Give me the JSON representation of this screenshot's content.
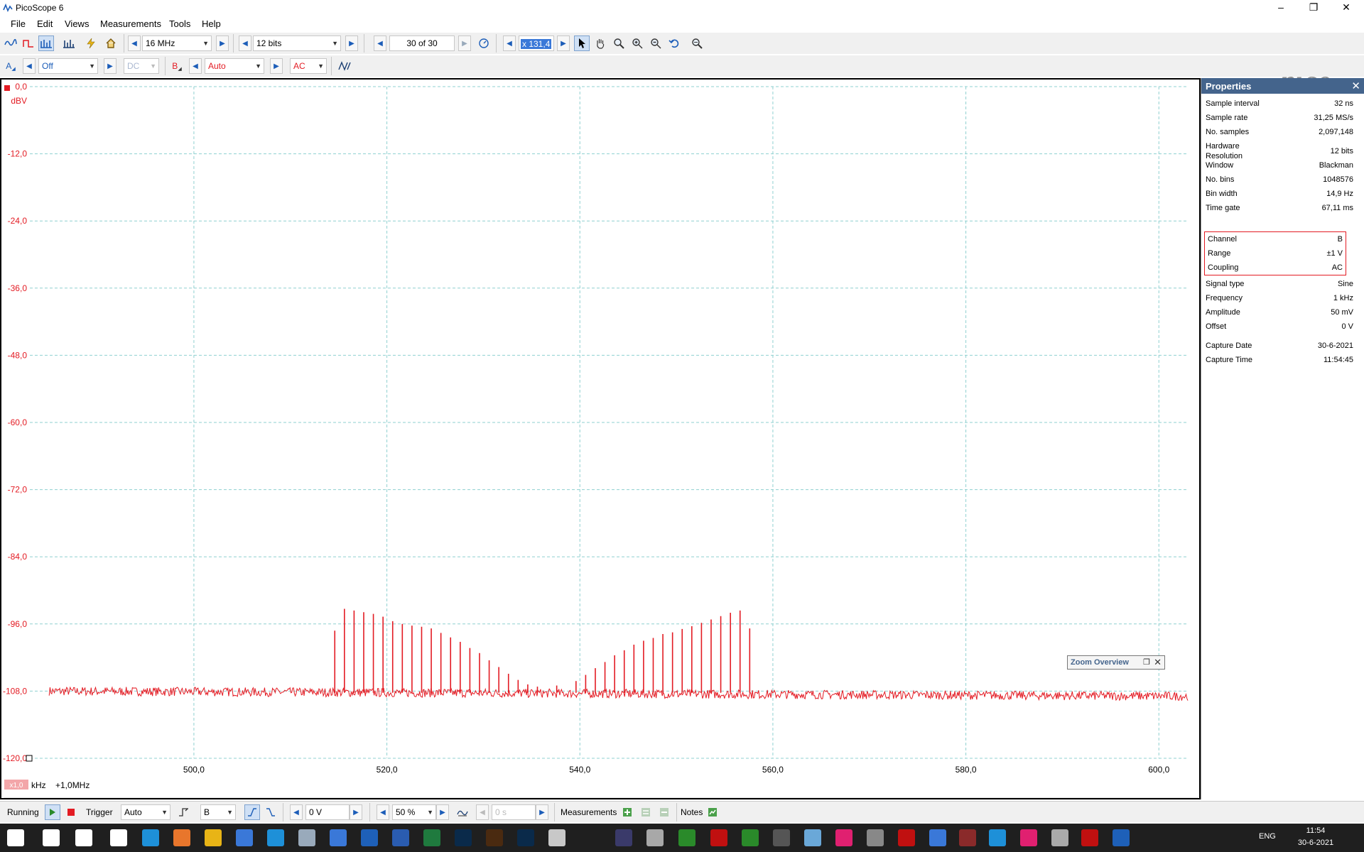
{
  "window": {
    "title": "PicoScope 6"
  },
  "menu": {
    "file": "File",
    "edit": "Edit",
    "views": "Views",
    "measurements": "Measurements",
    "tools": "Tools",
    "help": "Help"
  },
  "toolbar1": {
    "bandwidth": "16 MHz",
    "resolution": "12 bits",
    "buffer": "30 of 30",
    "zoom": "x 131,4"
  },
  "toolbar2": {
    "chA_label": "A",
    "chA_range": "Off",
    "chA_coupling": "DC",
    "chB_label": "B",
    "chB_range": "Auto",
    "chB_coupling": "AC"
  },
  "colors": {
    "channel_b": "#e31b23",
    "grid": "#8fd0d0",
    "accent": "#44648c"
  },
  "chart_data": {
    "type": "line",
    "y_unit": "dBV",
    "x_unit": "kHz",
    "x_offset_label": "+1,0MHz",
    "scale_badge": "x1,0",
    "y_ticks": [
      "0,0",
      "-12,0",
      "-24,0",
      "-36,0",
      "-48,0",
      "-60,0",
      "-72,0",
      "-84,0",
      "-96,0",
      "-108,0",
      "-120,0"
    ],
    "x_ticks": [
      "500,0",
      "520,0",
      "540,0",
      "560,0",
      "580,0",
      "600,0"
    ],
    "ylim": [
      -120,
      0
    ],
    "xlim": [
      483,
      603
    ],
    "noise_floor_start": -108.0,
    "noise_floor_end": -108.9,
    "noise_x_range": [
      485,
      603
    ],
    "spurs": [
      {
        "x": 514.6,
        "y": -97.2
      },
      {
        "x": 515.6,
        "y": -93.3
      },
      {
        "x": 516.6,
        "y": -93.6
      },
      {
        "x": 517.6,
        "y": -93.9
      },
      {
        "x": 518.6,
        "y": -94.2
      },
      {
        "x": 519.6,
        "y": -94.7
      },
      {
        "x": 520.6,
        "y": -95.5
      },
      {
        "x": 521.6,
        "y": -96.0
      },
      {
        "x": 522.6,
        "y": -96.3
      },
      {
        "x": 523.6,
        "y": -96.5
      },
      {
        "x": 524.6,
        "y": -96.8
      },
      {
        "x": 525.6,
        "y": -97.6
      },
      {
        "x": 526.6,
        "y": -98.4
      },
      {
        "x": 527.6,
        "y": -99.2
      },
      {
        "x": 528.6,
        "y": -100.3
      },
      {
        "x": 529.6,
        "y": -101.2
      },
      {
        "x": 530.6,
        "y": -102.5
      },
      {
        "x": 531.6,
        "y": -103.7
      },
      {
        "x": 532.6,
        "y": -104.9
      },
      {
        "x": 533.6,
        "y": -106.0
      },
      {
        "x": 534.6,
        "y": -106.8
      },
      {
        "x": 535.6,
        "y": -107.2
      },
      {
        "x": 537.6,
        "y": -107.0
      },
      {
        "x": 539.6,
        "y": -106.2
      },
      {
        "x": 540.6,
        "y": -105.1
      },
      {
        "x": 541.6,
        "y": -103.9
      },
      {
        "x": 542.6,
        "y": -102.8
      },
      {
        "x": 543.6,
        "y": -101.6
      },
      {
        "x": 544.6,
        "y": -100.7
      },
      {
        "x": 545.6,
        "y": -99.7
      },
      {
        "x": 546.6,
        "y": -99.0
      },
      {
        "x": 547.6,
        "y": -98.5
      },
      {
        "x": 548.6,
        "y": -97.8
      },
      {
        "x": 549.6,
        "y": -97.5
      },
      {
        "x": 550.6,
        "y": -96.9
      },
      {
        "x": 551.6,
        "y": -96.4
      },
      {
        "x": 552.6,
        "y": -95.8
      },
      {
        "x": 553.6,
        "y": -95.2
      },
      {
        "x": 554.6,
        "y": -94.6
      },
      {
        "x": 555.6,
        "y": -94.0
      },
      {
        "x": 556.6,
        "y": -93.6
      },
      {
        "x": 557.6,
        "y": -96.8
      }
    ]
  },
  "zoom_overview": {
    "title": "Zoom Overview"
  },
  "properties": {
    "title": "Properties",
    "rows": [
      {
        "k": "Sample interval",
        "v": "32 ns"
      },
      {
        "k": "Sample rate",
        "v": "31,25 MS/s"
      },
      {
        "k": "No. samples",
        "v": "2,097,148"
      },
      {
        "k": "Hardware",
        "v": "12 bits",
        "k2": "Resolution"
      },
      {
        "k": "Window",
        "v": "Blackman"
      },
      {
        "k": "No. bins",
        "v": "1048576"
      },
      {
        "k": "Bin width",
        "v": "14,9 Hz"
      },
      {
        "k": "Time gate",
        "v": "67,11 ms"
      }
    ],
    "channel_rows": [
      {
        "k": "Channel",
        "v": "B"
      },
      {
        "k": "Range",
        "v": "±1 V"
      },
      {
        "k": "Coupling",
        "v": "AC"
      }
    ],
    "signal_rows": [
      {
        "k": "Signal type",
        "v": "Sine"
      },
      {
        "k": "Frequency",
        "v": "1 kHz"
      },
      {
        "k": "Amplitude",
        "v": "50 mV"
      },
      {
        "k": "Offset",
        "v": "0 V"
      }
    ],
    "capture_rows": [
      {
        "k": "Capture Date",
        "v": "30-6-2021"
      },
      {
        "k": "Capture Time",
        "v": "11:54:45"
      }
    ]
  },
  "statusbar": {
    "running": "Running",
    "trigger": "Trigger",
    "trigger_mode": "Auto",
    "trigger_channel": "B",
    "trigger_level": "0 V",
    "pretrigger": "50 %",
    "delay": "0 s",
    "measurements": "Measurements",
    "notes": "Notes"
  },
  "taskbar": {
    "lang": "ENG",
    "time": "11:54",
    "date": "30-6-2021"
  }
}
